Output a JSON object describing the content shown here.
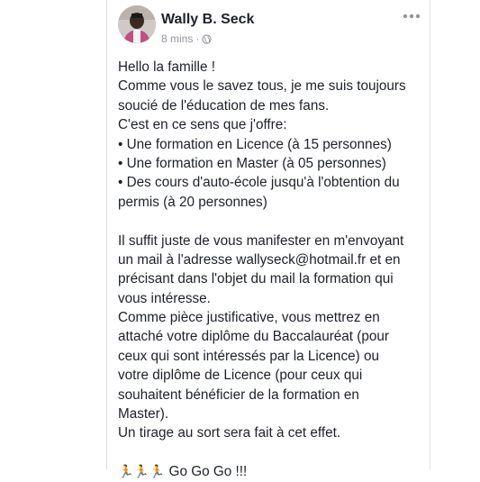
{
  "post": {
    "author": "Wally B. Seck",
    "time": "8 mins",
    "separator": "·",
    "privacy_icon": "globe-icon",
    "menu_icon": "more-options-icon",
    "paragraph1": [
      "Hello la famille !",
      "Comme vous le savez tous, je me suis toujours",
      "soucié de l'éducation de mes fans.",
      "C'est en ce sens que j'offre:",
      "• Une formation en Licence (à 15 personnes)",
      "• Une formation en Master (à 05 personnes)",
      "• Des cours d'auto-école jusqu'à l'obtention du",
      "permis (à 20 personnes)"
    ],
    "paragraph2": [
      "Il suffit juste de vous manifester en m'envoyant",
      "un mail à l'adresse wallyseck@hotmail.fr et en",
      "précisant dans l'objet du mail la formation qui",
      "vous intéresse.",
      "Comme pièce justificative, vous mettrez en",
      "attaché votre diplôme du Baccalauréat (pour",
      "ceux qui sont intéressés par la Licence) ou",
      "votre diplôme de Licence (pour ceux qui",
      "souhaitent bénéficier de la formation en",
      "Master).",
      "Un tirage au sort sera fait à cet effet."
    ],
    "closing_emoji": "🏃🏃🏃",
    "closing_text": "Go Go Go !!!"
  },
  "colors": {
    "text": "#1d2129",
    "meta": "#90949c",
    "border": "#dddfe2"
  }
}
